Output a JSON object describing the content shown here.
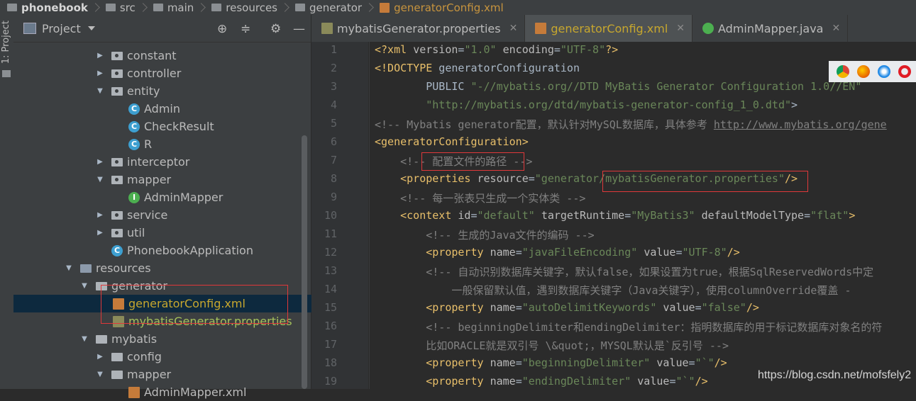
{
  "breadcrumb": [
    "phonebook",
    "src",
    "main",
    "resources",
    "generator",
    "generatorConfig.xml"
  ],
  "sidebar": {
    "vertical_tab": "1: Project"
  },
  "project_panel": {
    "title": "Project",
    "toolbar_icons": [
      "crosshair-icon",
      "collapse-icon",
      "gear-icon",
      "minimize-icon"
    ]
  },
  "tree": [
    {
      "label": "constant",
      "type": "package",
      "expanded": false
    },
    {
      "label": "controller",
      "type": "package",
      "expanded": false
    },
    {
      "label": "entity",
      "type": "package",
      "expanded": true
    },
    {
      "label": "Admin",
      "type": "class"
    },
    {
      "label": "CheckResult",
      "type": "class"
    },
    {
      "label": "R",
      "type": "class"
    },
    {
      "label": "interceptor",
      "type": "package",
      "expanded": false
    },
    {
      "label": "mapper",
      "type": "package",
      "expanded": true
    },
    {
      "label": "AdminMapper",
      "type": "interface"
    },
    {
      "label": "service",
      "type": "package",
      "expanded": false
    },
    {
      "label": "util",
      "type": "package",
      "expanded": false
    },
    {
      "label": "PhonebookApplication",
      "type": "springclass"
    },
    {
      "label": "resources",
      "type": "resources",
      "expanded": true
    },
    {
      "label": "generator",
      "type": "folder",
      "expanded": true
    },
    {
      "label": "generatorConfig.xml",
      "type": "xml",
      "selected": true
    },
    {
      "label": "mybatisGenerator.properties",
      "type": "properties"
    },
    {
      "label": "mybatis",
      "type": "folder",
      "expanded": true
    },
    {
      "label": "config",
      "type": "folder",
      "expanded": false
    },
    {
      "label": "mapper",
      "type": "folder",
      "expanded": true
    },
    {
      "label": "AdminMapper.xml",
      "type": "xml"
    }
  ],
  "tabs": [
    {
      "label": "mybatisGenerator.properties",
      "icon": "properties-file-icon",
      "active": false
    },
    {
      "label": "generatorConfig.xml",
      "icon": "xml-file-icon",
      "active": true
    },
    {
      "label": "AdminMapper.java",
      "icon": "interface-icon",
      "active": false
    }
  ],
  "editor": {
    "line_numbers": [
      "1",
      "2",
      "3",
      "4",
      "5",
      "6",
      "7",
      "8",
      "9",
      "10",
      "11",
      "12",
      "13",
      "14",
      "15",
      "16",
      "17",
      "18",
      "19"
    ],
    "lines": [
      "<?xml version=\"1.0\" encoding=\"UTF-8\"?>",
      "<!DOCTYPE generatorConfiguration",
      "        PUBLIC \"-//mybatis.org//DTD MyBatis Generator Configuration 1.0//EN\"",
      "        \"http://mybatis.org/dtd/mybatis-generator-config_1_0.dtd\">",
      "<!-- Mybatis generator配置，默认针对MySQL数据库，具体参考 http://www.mybatis.org/gene",
      "<generatorConfiguration>",
      "    <!-- 配置文件的路径 -->",
      "    <properties resource=\"generator/mybatisGenerator.properties\"/>",
      "    <!-- 每一张表只生成一个实体类 -->",
      "    <context id=\"default\" targetRuntime=\"MyBatis3\" defaultModelType=\"flat\">",
      "        <!-- 生成的Java文件的编码 -->",
      "        <property name=\"javaFileEncoding\" value=\"UTF-8\"/>",
      "        <!-- 自动识别数据库关键字，默认false，如果设置为true，根据SqlReservedWords中定",
      "            一般保留默认值，遇到数据库关键字（Java关键字），使用columnOverride覆盖 -",
      "        <property name=\"autoDelimitKeywords\" value=\"false\"/>",
      "        <!-- beginningDelimiter和endingDelimiter：指明数据库的用于标记数据库对象名的符",
      "        比如ORACLE就是双引号 \\&quot;，MYSQL默认是`反引号 -->",
      "        <property name=\"beginningDelimiter\" value=\"`\"/>",
      "        <property name=\"endingDelimiter\" value=\"`\"/>"
    ]
  },
  "browser_icons": [
    "chrome-icon",
    "firefox-icon",
    "safari-icon",
    "opera-icon"
  ],
  "watermark": "https://blog.csdn.net/mofsfely2"
}
